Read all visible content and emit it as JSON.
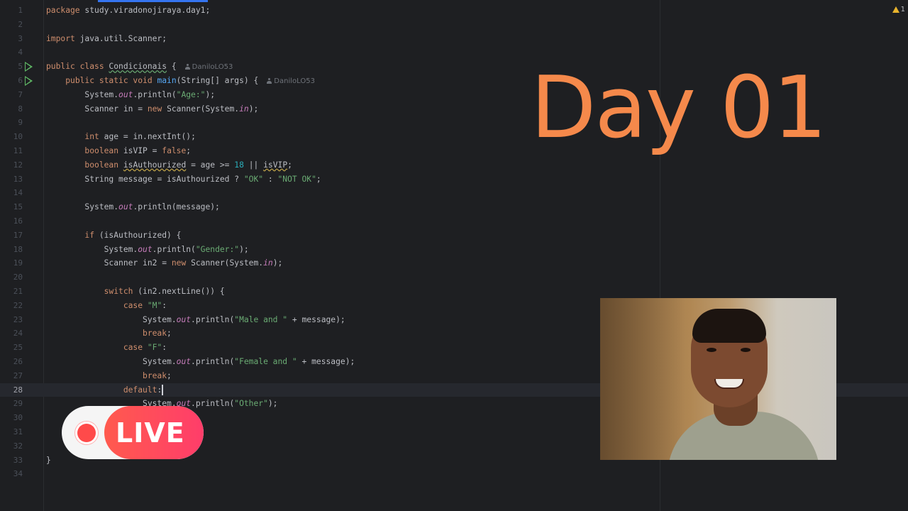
{
  "editor": {
    "warning_count": "1",
    "current_line": 28
  },
  "code_lines": [
    {
      "n": "1",
      "indent": 0,
      "tokens": [
        {
          "t": "package ",
          "c": "kw"
        },
        {
          "t": "study.viradonojiraya.day1;"
        }
      ]
    },
    {
      "n": "2",
      "indent": 0,
      "tokens": []
    },
    {
      "n": "3",
      "indent": 0,
      "tokens": [
        {
          "t": "import ",
          "c": "kw"
        },
        {
          "t": "java.util.Scanner;"
        }
      ]
    },
    {
      "n": "4",
      "indent": 0,
      "tokens": []
    },
    {
      "n": "5",
      "indent": 0,
      "run": true,
      "author": "DaniloLO53",
      "tokens": [
        {
          "t": "public class ",
          "c": "kw"
        },
        {
          "t": "Condicionais",
          "c": "cls"
        },
        {
          "t": " {"
        }
      ]
    },
    {
      "n": "6",
      "indent": 4,
      "run": true,
      "author": "DaniloLO53",
      "tokens": [
        {
          "t": "public static void ",
          "c": "kw"
        },
        {
          "t": "main",
          "c": "fn"
        },
        {
          "t": "(String[] args) {"
        }
      ]
    },
    {
      "n": "7",
      "indent": 8,
      "tokens": [
        {
          "t": "System."
        },
        {
          "t": "out",
          "c": "fld"
        },
        {
          "t": ".println("
        },
        {
          "t": "\"Age:\"",
          "c": "str"
        },
        {
          "t": ");"
        }
      ]
    },
    {
      "n": "8",
      "indent": 8,
      "tokens": [
        {
          "t": "Scanner in = "
        },
        {
          "t": "new ",
          "c": "kw"
        },
        {
          "t": "Scanner(System."
        },
        {
          "t": "in",
          "c": "fld"
        },
        {
          "t": ");"
        }
      ]
    },
    {
      "n": "9",
      "indent": 0,
      "tokens": []
    },
    {
      "n": "10",
      "indent": 8,
      "tokens": [
        {
          "t": "int ",
          "c": "kw"
        },
        {
          "t": "age = in.nextInt();"
        }
      ]
    },
    {
      "n": "11",
      "indent": 8,
      "tokens": [
        {
          "t": "boolean ",
          "c": "kw"
        },
        {
          "t": "isVIP = "
        },
        {
          "t": "false",
          "c": "kw"
        },
        {
          "t": ";"
        }
      ]
    },
    {
      "n": "12",
      "indent": 8,
      "tokens": [
        {
          "t": "boolean ",
          "c": "kw"
        },
        {
          "t": "isAuthourized",
          "c": "warn"
        },
        {
          "t": " = age >= "
        },
        {
          "t": "18",
          "c": "num"
        },
        {
          "t": " || "
        },
        {
          "t": "isVIP",
          "c": "warn"
        },
        {
          "t": ";"
        }
      ]
    },
    {
      "n": "13",
      "indent": 8,
      "tokens": [
        {
          "t": "String message = isAuthourized ? "
        },
        {
          "t": "\"OK\"",
          "c": "str"
        },
        {
          "t": " : "
        },
        {
          "t": "\"NOT OK\"",
          "c": "str"
        },
        {
          "t": ";"
        }
      ]
    },
    {
      "n": "14",
      "indent": 0,
      "tokens": []
    },
    {
      "n": "15",
      "indent": 8,
      "tokens": [
        {
          "t": "System."
        },
        {
          "t": "out",
          "c": "fld"
        },
        {
          "t": ".println(message);"
        }
      ]
    },
    {
      "n": "16",
      "indent": 0,
      "tokens": []
    },
    {
      "n": "17",
      "indent": 8,
      "tokens": [
        {
          "t": "if ",
          "c": "kw"
        },
        {
          "t": "(isAuthourized) {"
        }
      ]
    },
    {
      "n": "18",
      "indent": 12,
      "tokens": [
        {
          "t": "System."
        },
        {
          "t": "out",
          "c": "fld"
        },
        {
          "t": ".println("
        },
        {
          "t": "\"Gender:\"",
          "c": "str"
        },
        {
          "t": ");"
        }
      ]
    },
    {
      "n": "19",
      "indent": 12,
      "tokens": [
        {
          "t": "Scanner in2 = "
        },
        {
          "t": "new ",
          "c": "kw"
        },
        {
          "t": "Scanner(System."
        },
        {
          "t": "in",
          "c": "fld"
        },
        {
          "t": ");"
        }
      ]
    },
    {
      "n": "20",
      "indent": 0,
      "tokens": []
    },
    {
      "n": "21",
      "indent": 12,
      "tokens": [
        {
          "t": "switch ",
          "c": "kw"
        },
        {
          "t": "(in2.nextLine()) {"
        }
      ]
    },
    {
      "n": "22",
      "indent": 16,
      "tokens": [
        {
          "t": "case ",
          "c": "kw"
        },
        {
          "t": "\"M\"",
          "c": "str"
        },
        {
          "t": ":"
        }
      ]
    },
    {
      "n": "23",
      "indent": 20,
      "tokens": [
        {
          "t": "System."
        },
        {
          "t": "out",
          "c": "fld"
        },
        {
          "t": ".println("
        },
        {
          "t": "\"Male and \"",
          "c": "str"
        },
        {
          "t": " + message);"
        }
      ]
    },
    {
      "n": "24",
      "indent": 20,
      "tokens": [
        {
          "t": "break",
          "c": "kw"
        },
        {
          "t": ";"
        }
      ]
    },
    {
      "n": "25",
      "indent": 16,
      "tokens": [
        {
          "t": "case ",
          "c": "kw"
        },
        {
          "t": "\"F\"",
          "c": "str"
        },
        {
          "t": ":"
        }
      ]
    },
    {
      "n": "26",
      "indent": 20,
      "tokens": [
        {
          "t": "System."
        },
        {
          "t": "out",
          "c": "fld"
        },
        {
          "t": ".println("
        },
        {
          "t": "\"Female and \"",
          "c": "str"
        },
        {
          "t": " + message);"
        }
      ]
    },
    {
      "n": "27",
      "indent": 20,
      "tokens": [
        {
          "t": "break",
          "c": "kw"
        },
        {
          "t": ";"
        }
      ]
    },
    {
      "n": "28",
      "indent": 16,
      "caret": true,
      "tokens": [
        {
          "t": "default",
          "c": "kw"
        },
        {
          "t": ":"
        }
      ]
    },
    {
      "n": "29",
      "indent": 20,
      "tokens": [
        {
          "t": "System."
        },
        {
          "t": "out",
          "c": "fld"
        },
        {
          "t": ".println("
        },
        {
          "t": "\"Other\"",
          "c": "str"
        },
        {
          "t": ");"
        }
      ]
    },
    {
      "n": "30",
      "indent": 0,
      "tokens": []
    },
    {
      "n": "31",
      "indent": 0,
      "tokens": []
    },
    {
      "n": "32",
      "indent": 0,
      "tokens": []
    },
    {
      "n": "33",
      "indent": 0,
      "tokens": [
        {
          "t": "}"
        }
      ]
    },
    {
      "n": "34",
      "indent": 0,
      "tokens": []
    }
  ],
  "overlay": {
    "title": "Day 01",
    "live_label": "LIVE"
  }
}
